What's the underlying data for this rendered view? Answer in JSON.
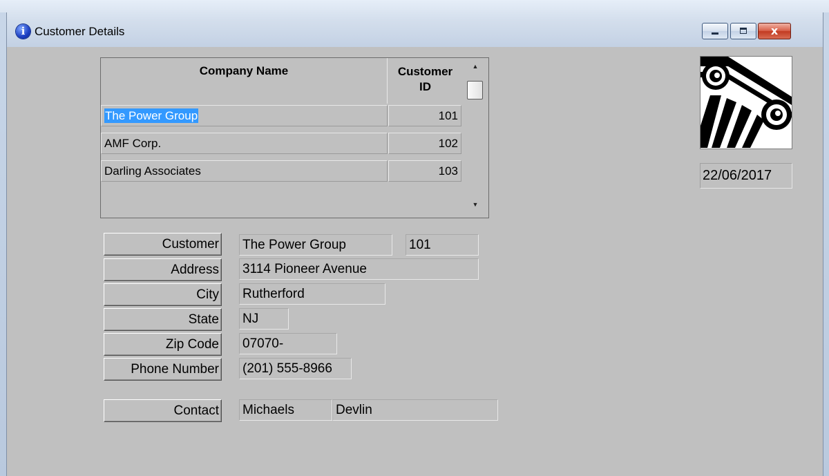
{
  "window": {
    "title": "Customer Details",
    "close_glyph": "x"
  },
  "grid": {
    "headers": {
      "company": "Company Name",
      "id_line1": "Customer",
      "id_line2": "ID"
    },
    "rows": [
      {
        "company": "The Power Group",
        "id": "101"
      },
      {
        "company": "AMF Corp.",
        "id": "102"
      },
      {
        "company": "Darling Associates",
        "id": "103"
      }
    ],
    "selected_index": 0
  },
  "date": "22/06/2017",
  "form": {
    "labels": {
      "customer": "Customer",
      "address": "Address",
      "city": "City",
      "state": "State",
      "zip": "Zip Code",
      "phone": "Phone Number",
      "contact": "Contact"
    },
    "values": {
      "customer_name": "The Power Group",
      "customer_id": "101",
      "address": "3114 Pioneer Avenue",
      "city": "Rutherford",
      "state": "NJ",
      "zip": "07070-",
      "phone": "(201) 555-8966",
      "contact_last": "Michaels",
      "contact_first": "Devlin"
    }
  },
  "icons": {
    "title": "info-icon",
    "logo": "ionic-column-logo-icon"
  },
  "colors": {
    "selection": "#3399ff",
    "form_background": "#c0c0c0"
  }
}
